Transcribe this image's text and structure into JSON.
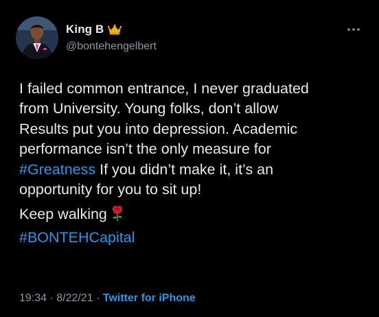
{
  "tweet": {
    "author": {
      "display_name": "King B",
      "badge_icon": "crown-icon",
      "handle": "@bontehengelbert"
    },
    "more_icon": "more-icon",
    "paragraph1": {
      "line1": "I failed common entrance, I never graduated",
      "line2": "from University. Young folks, don’t allow",
      "line3": "Results put you into depression. Academic",
      "line4": "performance isn’t the only measure for",
      "hashtag1": "#Greatness",
      "line5_rest": " If you didn’t make it, it’s an",
      "line6": "opportunity for you to sit up!"
    },
    "paragraph2": {
      "text": "Keep walking",
      "emoji_icon": "rose-icon",
      "hashtag2": "#BONTEHCapital"
    },
    "meta": {
      "time": "19:34",
      "sep1": " · ",
      "date": "8/22/21",
      "sep2": " · ",
      "source": "Twitter for iPhone"
    },
    "colors": {
      "background": "#000000",
      "text": "#e7e9ea",
      "secondary": "#8b98a5",
      "accent": "#1d9bf0"
    }
  }
}
